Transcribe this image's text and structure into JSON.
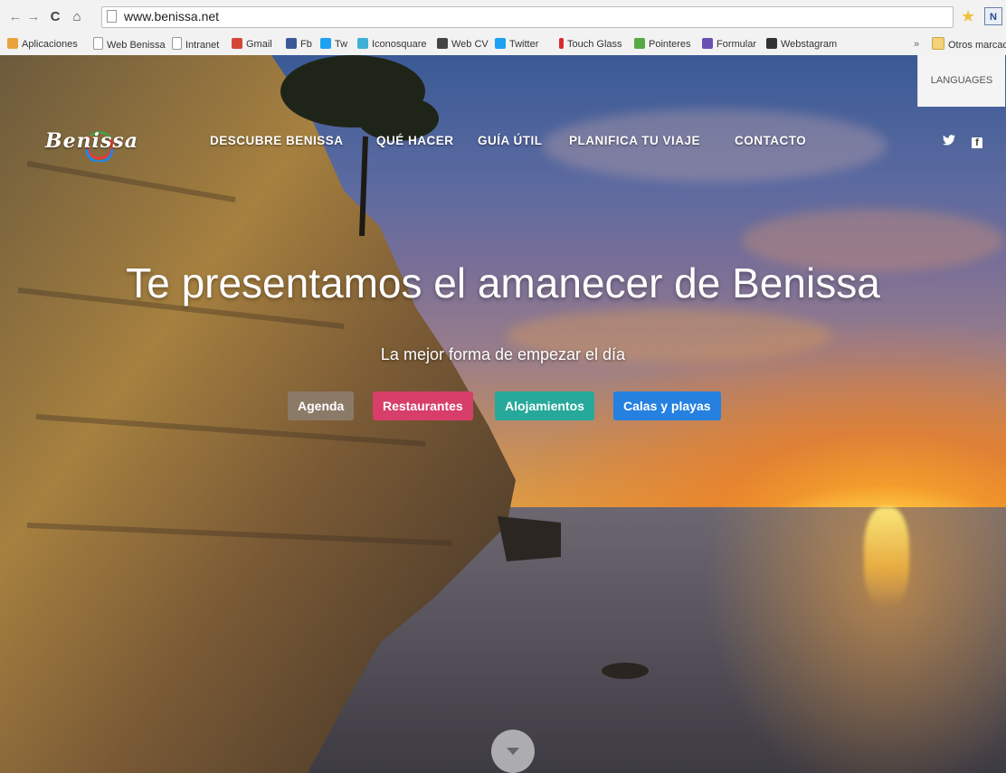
{
  "browser": {
    "url": "www.benissa.net",
    "extension_label": "N",
    "bookmarks": [
      {
        "label": "Aplicaciones",
        "icon": "apps-grid-icon",
        "color": "#e8a33a"
      },
      {
        "label": "Web Benissa",
        "icon": "page-icon",
        "color": "#cccccc"
      },
      {
        "label": "Intranet",
        "icon": "page-icon",
        "color": "#cccccc"
      },
      {
        "label": "Gmail",
        "icon": "gmail-icon",
        "color": "#d44638"
      },
      {
        "label": "Fb",
        "icon": "facebook-icon",
        "color": "#3b5998"
      },
      {
        "label": "Tw",
        "icon": "twitter-icon",
        "color": "#1da1f2"
      },
      {
        "label": "Iconosquare",
        "icon": "iconosquare-icon",
        "color": "#3fb0d8"
      },
      {
        "label": "Web CV",
        "icon": "webcv-icon",
        "color": "#444444"
      },
      {
        "label": "Twitter",
        "icon": "twitter-icon",
        "color": "#1da1f2"
      },
      {
        "label": "Touch Glass",
        "icon": "touchglass-icon",
        "color": "#d92b2b"
      },
      {
        "label": "Pointeres",
        "icon": "pointeres-icon",
        "color": "#55aa44"
      },
      {
        "label": "Formular",
        "icon": "form-icon",
        "color": "#6a4fb3"
      },
      {
        "label": "Webstagram",
        "icon": "webstagram-icon",
        "color": "#333333"
      }
    ],
    "more_chevron": "»",
    "other_bookmarks": "Otros marcad"
  },
  "site": {
    "languages": "LANGUAGES",
    "logo_text": "Benissa",
    "nav": [
      "DESCUBRE BENISSA",
      "QUÉ HACER",
      "GUÍA ÚTIL",
      "PLANIFICA TU VIAJE",
      "CONTACTO"
    ],
    "social": {
      "twitter": "twitter-icon",
      "facebook": "facebook-icon"
    },
    "headline": "Te presentamos el amanecer de Benissa",
    "subheadline": "La mejor forma de empezar el día",
    "buttons": [
      {
        "label": "Agenda",
        "color": "#8c7a69"
      },
      {
        "label": "Restaurantes",
        "color": "#d73e6a"
      },
      {
        "label": "Alojamientos",
        "color": "#26a99a"
      },
      {
        "label": "Calas y playas",
        "color": "#2580e0"
      }
    ]
  }
}
